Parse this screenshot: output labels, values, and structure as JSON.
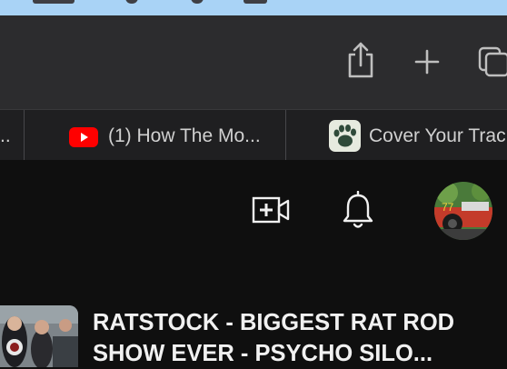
{
  "browser": {
    "toolbar": {
      "share_icon": "share-icon",
      "new_tab_icon": "plus-icon",
      "tab_overview_icon": "tab-overview-icon"
    },
    "tabs": [
      {
        "label": "..",
        "icon": "none"
      },
      {
        "label": "(1) How The Mo...",
        "icon": "youtube-icon",
        "icon_color": "#ff0000"
      },
      {
        "label": "Cover Your Trac",
        "icon": "bear-paw-icon"
      }
    ]
  },
  "youtube": {
    "header": {
      "create_icon": "video-plus-icon",
      "notifications_icon": "bell-icon",
      "avatar": "profile-avatar"
    },
    "video": {
      "title": "RATSTOCK - BIGGEST RAT ROD\nSHOW EVER - PSYCHO SILO..."
    }
  },
  "colors": {
    "menu_strip": "#a9d3f6",
    "toolbar_bg": "#2c2c2e",
    "tabbar_bg": "#1f1f21",
    "page_bg": "#0f0f0f",
    "youtube_red": "#ff0000"
  }
}
